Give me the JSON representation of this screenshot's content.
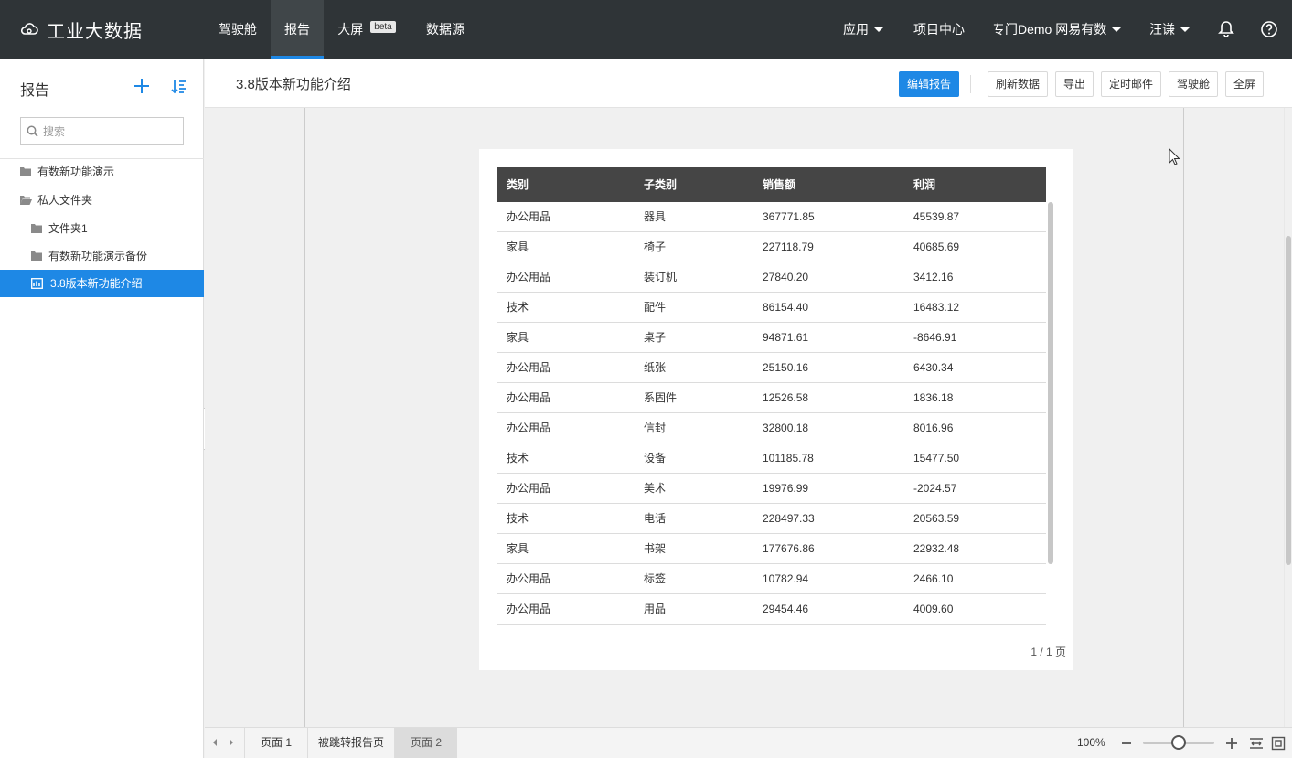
{
  "app": {
    "name": "工业大数据",
    "nav": [
      "驾驶舱",
      "报告",
      "大屏",
      "数据源"
    ],
    "beta": "beta",
    "apps_menu": "应用",
    "project_center": "项目中心",
    "project_name": "专门Demo 网易有数",
    "user": "汪谦"
  },
  "sidebar": {
    "title": "报告",
    "search_placeholder": "搜索",
    "items": [
      {
        "label": "有数新功能演示",
        "icon": "folder-icon"
      },
      {
        "label": "私人文件夹",
        "icon": "folder-open-icon"
      },
      {
        "label": "文件夹1",
        "icon": "folder-icon"
      },
      {
        "label": "有数新功能演示备份",
        "icon": "folder-icon"
      },
      {
        "label": "3.8版本新功能介绍",
        "icon": "report-chart-icon"
      }
    ]
  },
  "header": {
    "title": "3.8版本新功能介绍",
    "edit": "编辑报告",
    "refresh": "刷新数据",
    "export": "导出",
    "schedule": "定时邮件",
    "cockpit": "驾驶舱",
    "fullscreen": "全屏"
  },
  "table": {
    "columns": [
      "类别",
      "子类别",
      "销售额",
      "利润"
    ],
    "rows": [
      [
        "办公用品",
        "器具",
        "367771.85",
        "45539.87"
      ],
      [
        "家具",
        "椅子",
        "227118.79",
        "40685.69"
      ],
      [
        "办公用品",
        "装订机",
        "27840.20",
        "3412.16"
      ],
      [
        "技术",
        "配件",
        "86154.40",
        "16483.12"
      ],
      [
        "家具",
        "桌子",
        "94871.61",
        "-8646.91"
      ],
      [
        "办公用品",
        "纸张",
        "25150.16",
        "6430.34"
      ],
      [
        "办公用品",
        "系固件",
        "12526.58",
        "1836.18"
      ],
      [
        "办公用品",
        "信封",
        "32800.18",
        "8016.96"
      ],
      [
        "技术",
        "设备",
        "101185.78",
        "15477.50"
      ],
      [
        "办公用品",
        "美术",
        "19976.99",
        "-2024.57"
      ],
      [
        "技术",
        "电话",
        "228497.33",
        "20563.59"
      ],
      [
        "家具",
        "书架",
        "177676.86",
        "22932.48"
      ],
      [
        "办公用品",
        "标签",
        "10782.94",
        "2466.10"
      ],
      [
        "办公用品",
        "用品",
        "29454.46",
        "4009.60"
      ]
    ],
    "pager": "1 / 1 页"
  },
  "footer": {
    "pages": [
      "页面 1",
      "被跳转报告页",
      "页面 2"
    ],
    "active_page": "页面 2",
    "zoom": "100%"
  }
}
